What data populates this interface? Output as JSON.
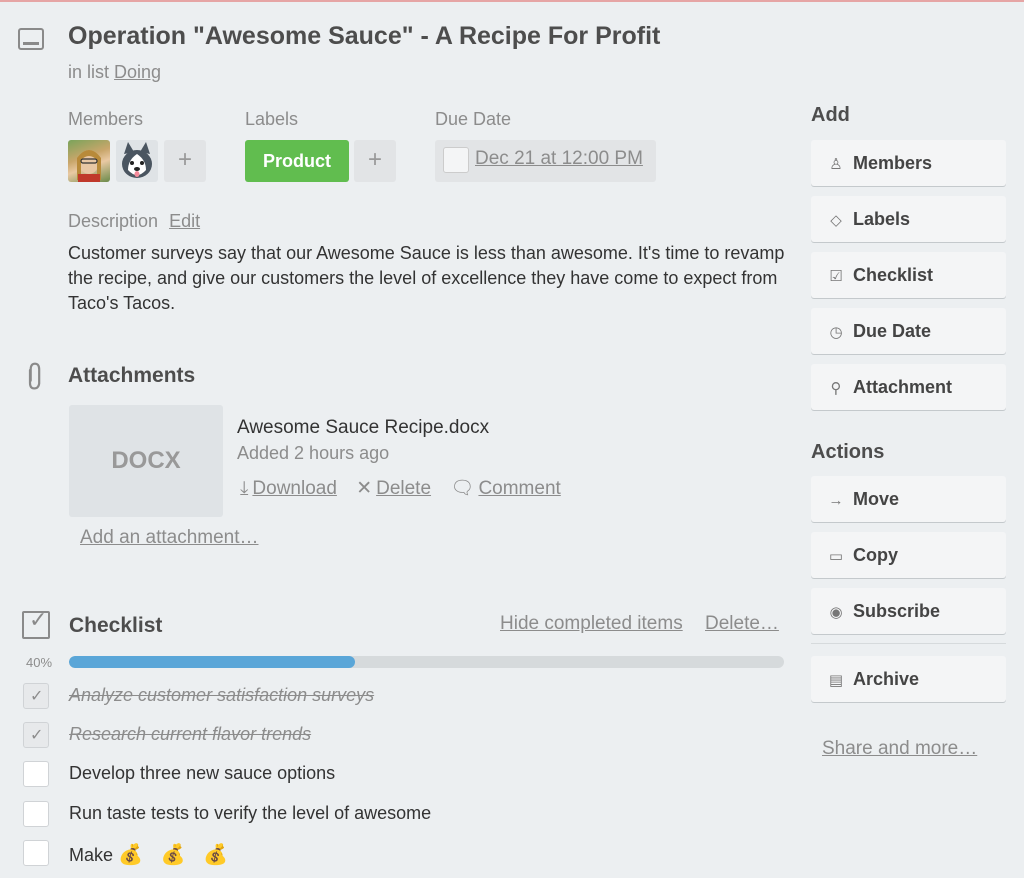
{
  "card": {
    "title": "Operation \"Awesome Sauce\" - A Recipe For Profit",
    "in_list_prefix": "in list",
    "list_name": "Doing"
  },
  "members": {
    "label": "Members",
    "add": "+"
  },
  "labels": {
    "label": "Labels",
    "items": [
      {
        "text": "Product",
        "color": "#61bd4f"
      }
    ],
    "add": "+"
  },
  "due": {
    "label": "Due Date",
    "value": "Dec 21 at 12:00 PM"
  },
  "description": {
    "label": "Description",
    "edit": "Edit",
    "text": "Customer surveys say that our Awesome Sauce is less than awesome. It's time to revamp the recipe, and give our customers the level of excellence they have come to expect from Taco's Tacos."
  },
  "attachments": {
    "title": "Attachments",
    "items": [
      {
        "thumb": "DOCX",
        "name": "Awesome Sauce Recipe.docx",
        "added": "Added 2 hours ago",
        "download": "Download",
        "delete": "Delete",
        "comment": "Comment"
      }
    ],
    "add": "Add an attachment…"
  },
  "checklist": {
    "title": "Checklist",
    "hide_completed": "Hide completed items",
    "delete": "Delete…",
    "percent_label": "40%",
    "progress": 0.4,
    "progress_color": "#5aa6d8",
    "items": [
      {
        "text": "Analyze customer satisfaction surveys",
        "done": true
      },
      {
        "text": "Research current flavor trends",
        "done": true
      },
      {
        "text": "Develop three new sauce options",
        "done": false
      },
      {
        "text": "Run taste tests to verify the level of awesome",
        "done": false
      },
      {
        "text": "Make",
        "done": false,
        "emoji": "💰 💰 💰"
      }
    ]
  },
  "sidebar": {
    "add_heading": "Add",
    "add_buttons": [
      {
        "label": "Members",
        "icon": "person-icon"
      },
      {
        "label": "Labels",
        "icon": "tag-icon"
      },
      {
        "label": "Checklist",
        "icon": "checklist-icon"
      },
      {
        "label": "Due Date",
        "icon": "clock-icon"
      },
      {
        "label": "Attachment",
        "icon": "paperclip-icon"
      }
    ],
    "actions_heading": "Actions",
    "action_buttons": [
      {
        "label": "Move",
        "icon": "arrow-right-icon"
      },
      {
        "label": "Copy",
        "icon": "card-icon"
      },
      {
        "label": "Subscribe",
        "icon": "eye-icon"
      },
      {
        "label": "Archive",
        "icon": "archive-icon"
      }
    ],
    "share": "Share and more…"
  }
}
